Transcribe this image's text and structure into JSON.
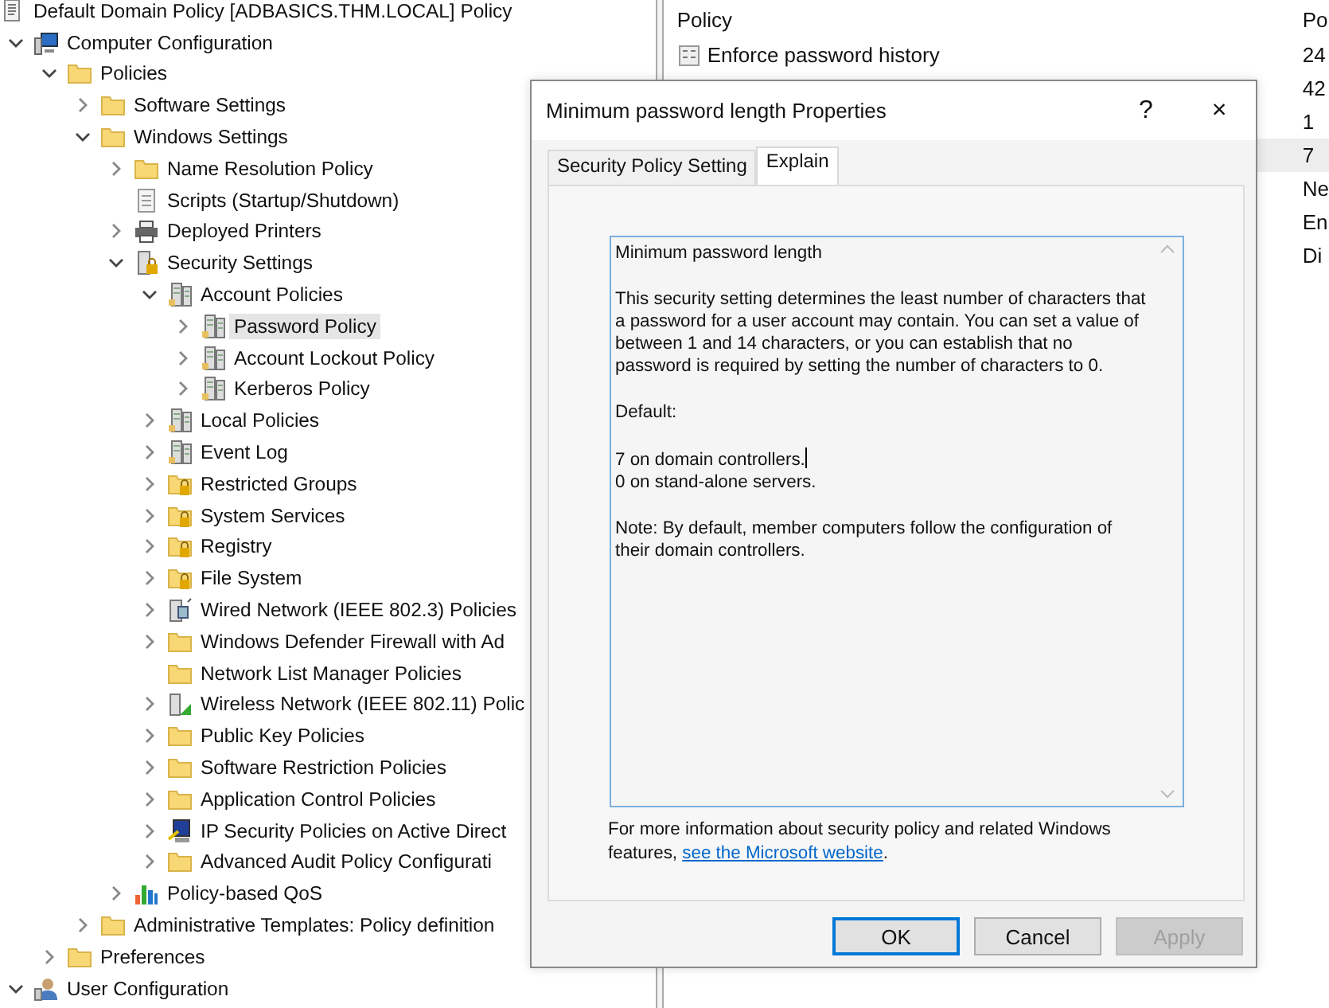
{
  "tree": [
    {
      "label": "Default Domain Policy [ADBASICS.THM.LOCAL] Policy",
      "kind": "scroll",
      "selected": false,
      "children": [
        {
          "label": "Computer Configuration",
          "kind": "computer",
          "expandable": true,
          "expanded": true,
          "selected": false,
          "children": [
            {
              "label": "Policies",
              "kind": "folder",
              "expandable": true,
              "expanded": true,
              "selected": false,
              "children": [
                {
                  "label": "Software Settings",
                  "kind": "folder",
                  "expandable": true,
                  "expanded": false,
                  "selected": false
                },
                {
                  "label": "Windows Settings",
                  "kind": "folder",
                  "expandable": true,
                  "expanded": true,
                  "selected": false,
                  "children": [
                    {
                      "label": "Name Resolution Policy",
                      "kind": "folder",
                      "expandable": true,
                      "expanded": false,
                      "selected": false
                    },
                    {
                      "label": "Scripts (Startup/Shutdown)",
                      "kind": "script",
                      "expandable": false,
                      "expanded": false,
                      "selected": false
                    },
                    {
                      "label": "Deployed Printers",
                      "kind": "printer",
                      "expandable": true,
                      "expanded": false,
                      "selected": false
                    },
                    {
                      "label": "Security Settings",
                      "kind": "security",
                      "expandable": true,
                      "expanded": true,
                      "selected": false,
                      "children": [
                        {
                          "label": "Account Policies",
                          "kind": "server",
                          "expandable": true,
                          "expanded": true,
                          "selected": false,
                          "children": [
                            {
                              "label": "Password Policy",
                              "kind": "server",
                              "expandable": true,
                              "expanded": false,
                              "selected": true
                            },
                            {
                              "label": "Account Lockout Policy",
                              "kind": "server",
                              "expandable": true,
                              "expanded": false,
                              "selected": false
                            },
                            {
                              "label": "Kerberos Policy",
                              "kind": "server",
                              "expandable": true,
                              "expanded": false,
                              "selected": false
                            }
                          ]
                        },
                        {
                          "label": "Local Policies",
                          "kind": "server",
                          "expandable": true,
                          "expanded": false,
                          "selected": false
                        },
                        {
                          "label": "Event Log",
                          "kind": "server",
                          "expandable": true,
                          "expanded": false,
                          "selected": false
                        },
                        {
                          "label": "Restricted Groups",
                          "kind": "lockfolder",
                          "expandable": true,
                          "expanded": false,
                          "selected": false
                        },
                        {
                          "label": "System Services",
                          "kind": "lockfolder",
                          "expandable": true,
                          "expanded": false,
                          "selected": false
                        },
                        {
                          "label": "Registry",
                          "kind": "lockfolder",
                          "expandable": true,
                          "expanded": false,
                          "selected": false
                        },
                        {
                          "label": "File System",
                          "kind": "lockfolder",
                          "expandable": true,
                          "expanded": false,
                          "selected": false
                        },
                        {
                          "label": "Wired Network (IEEE 802.3) Policies",
                          "kind": "network",
                          "expandable": true,
                          "expanded": false,
                          "selected": false
                        },
                        {
                          "label": "Windows Defender Firewall with Ad",
                          "kind": "folder",
                          "expandable": true,
                          "expanded": false,
                          "selected": false
                        },
                        {
                          "label": "Network List Manager Policies",
                          "kind": "folder",
                          "expandable": false,
                          "expanded": false,
                          "selected": false
                        },
                        {
                          "label": "Wireless Network (IEEE 802.11) Polic",
                          "kind": "wireless",
                          "expandable": true,
                          "expanded": false,
                          "selected": false
                        },
                        {
                          "label": "Public Key Policies",
                          "kind": "folder",
                          "expandable": true,
                          "expanded": false,
                          "selected": false
                        },
                        {
                          "label": "Software Restriction Policies",
                          "kind": "folder",
                          "expandable": true,
                          "expanded": false,
                          "selected": false
                        },
                        {
                          "label": "Application Control Policies",
                          "kind": "folder",
                          "expandable": true,
                          "expanded": false,
                          "selected": false
                        },
                        {
                          "label": "IP Security Policies on Active Direct",
                          "kind": "ipsec",
                          "expandable": true,
                          "expanded": false,
                          "selected": false
                        },
                        {
                          "label": "Advanced Audit Policy Configurati",
                          "kind": "folder",
                          "expandable": true,
                          "expanded": false,
                          "selected": false
                        }
                      ]
                    },
                    {
                      "label": "Policy-based QoS",
                      "kind": "chart",
                      "expandable": true,
                      "expanded": false,
                      "selected": false
                    }
                  ]
                },
                {
                  "label": "Administrative Templates: Policy definition",
                  "kind": "folder",
                  "expandable": true,
                  "expanded": false,
                  "selected": false
                }
              ]
            },
            {
              "label": "Preferences",
              "kind": "folder",
              "expandable": true,
              "expanded": false,
              "selected": false
            }
          ]
        },
        {
          "label": "User Configuration",
          "kind": "user",
          "expandable": true,
          "expanded": true,
          "selected": false
        }
      ]
    }
  ],
  "policy_list": {
    "columns": [
      "Policy",
      "Po"
    ],
    "rows": [
      {
        "policy": "Enforce password history",
        "setting": "24",
        "selected": false
      },
      {
        "setting": "42",
        "selected": false
      },
      {
        "setting": "1",
        "selected": false
      },
      {
        "setting": "7",
        "selected": true
      },
      {
        "setting": "Ne",
        "selected": false
      },
      {
        "setting": "En",
        "selected": false
      },
      {
        "setting": "Di",
        "selected": false
      }
    ]
  },
  "dialog": {
    "title": "Minimum password length Properties",
    "help": "?",
    "close": "×",
    "tabs": [
      {
        "label": "Security Policy Setting",
        "selected": false
      },
      {
        "label": "Explain",
        "selected": true
      }
    ],
    "explain": [
      [
        "Minimum password length"
      ],
      [
        "This security setting determines the least number of characters that a password for a user account may contain. You can set a value of between 1 and 14 characters, or you can establish that no password is required by setting the number of characters to 0."
      ],
      [
        "Default:"
      ],
      [
        "7 on domain controllers.",
        "0 on stand-alone servers."
      ],
      [
        "Note: By default, member computers follow the configuration of their domain controllers."
      ]
    ],
    "info_text": "For more information about security policy and related Windows features, ",
    "info_link": "see the Microsoft website",
    "info_end": ".",
    "buttons": [
      {
        "label": "OK",
        "kind": "default",
        "disabled": false
      },
      {
        "label": "Cancel",
        "kind": "normal",
        "disabled": false
      },
      {
        "label": "Apply",
        "kind": "normal",
        "disabled": true
      }
    ]
  }
}
